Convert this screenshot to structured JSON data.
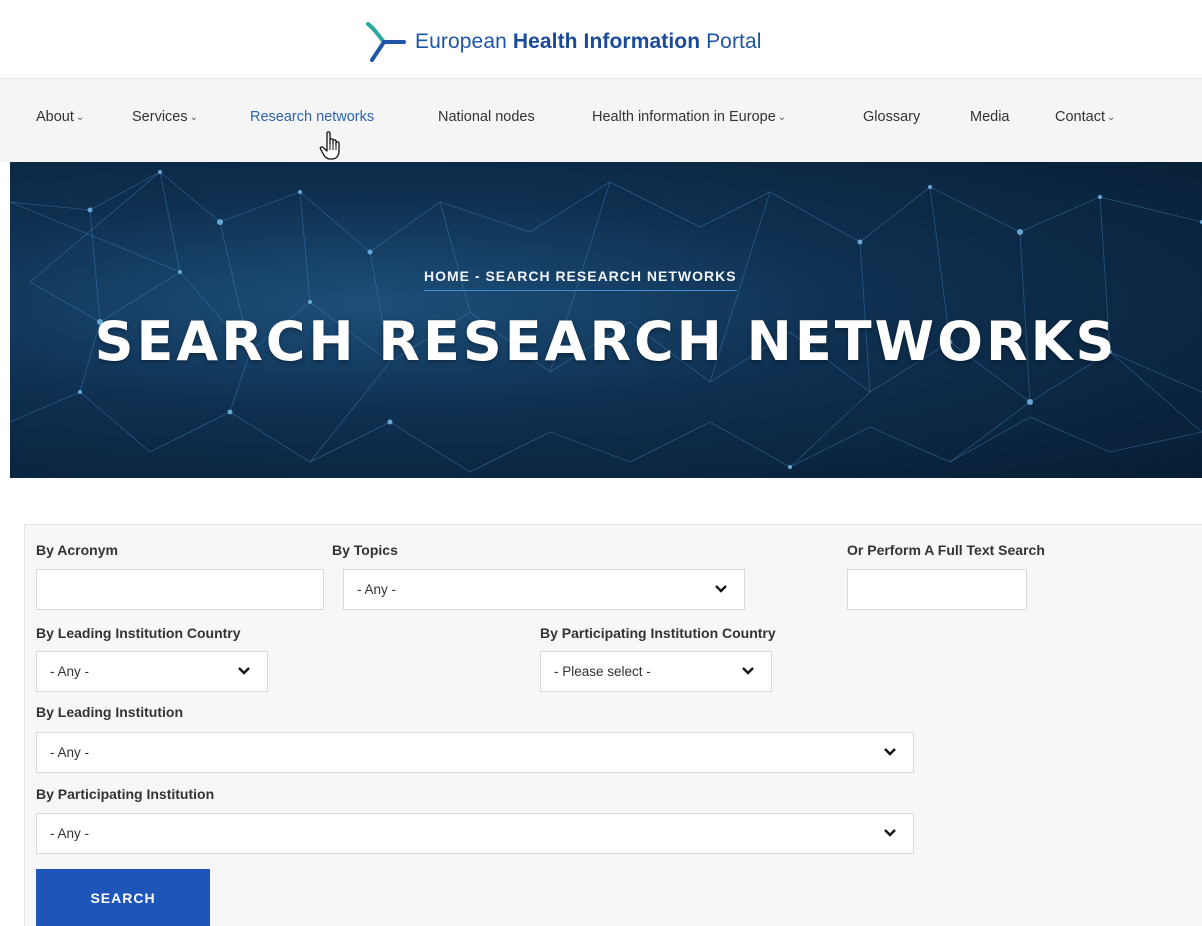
{
  "header": {
    "logo_text_part1": "European",
    "logo_text_part2": "Health Information",
    "logo_text_part3": "Portal"
  },
  "nav": {
    "items": [
      {
        "label": "About",
        "has_dropdown": true
      },
      {
        "label": "Services",
        "has_dropdown": true
      },
      {
        "label": "Research networks",
        "has_dropdown": false,
        "active": true
      },
      {
        "label": "National nodes",
        "has_dropdown": false
      },
      {
        "label": "Health information in Europe",
        "has_dropdown": true
      },
      {
        "label": "Glossary",
        "has_dropdown": false
      },
      {
        "label": "Media",
        "has_dropdown": false
      },
      {
        "label": "Contact",
        "has_dropdown": true
      }
    ]
  },
  "hero": {
    "breadcrumb": "HOME - SEARCH RESEARCH NETWORKS",
    "title": "SEARCH RESEARCH NETWORKS"
  },
  "form": {
    "acronym_label": "By Acronym",
    "acronym_value": "",
    "topics_label": "By Topics",
    "topics_value": "- Any -",
    "fulltext_label": "Or Perform A Full Text Search",
    "fulltext_value": "",
    "leading_country_label": "By Leading Institution Country",
    "leading_country_value": "- Any -",
    "participating_country_label": "By Participating Institution Country",
    "participating_country_value": "- Please select -",
    "leading_institution_label": "By Leading Institution",
    "leading_institution_value": "- Any -",
    "participating_institution_label": "By Participating Institution",
    "participating_institution_value": "- Any -",
    "search_button": "SEARCH"
  },
  "colors": {
    "brand_blue": "#1f55a8",
    "button_blue": "#1d55b8",
    "active_nav": "#2d63b0"
  }
}
